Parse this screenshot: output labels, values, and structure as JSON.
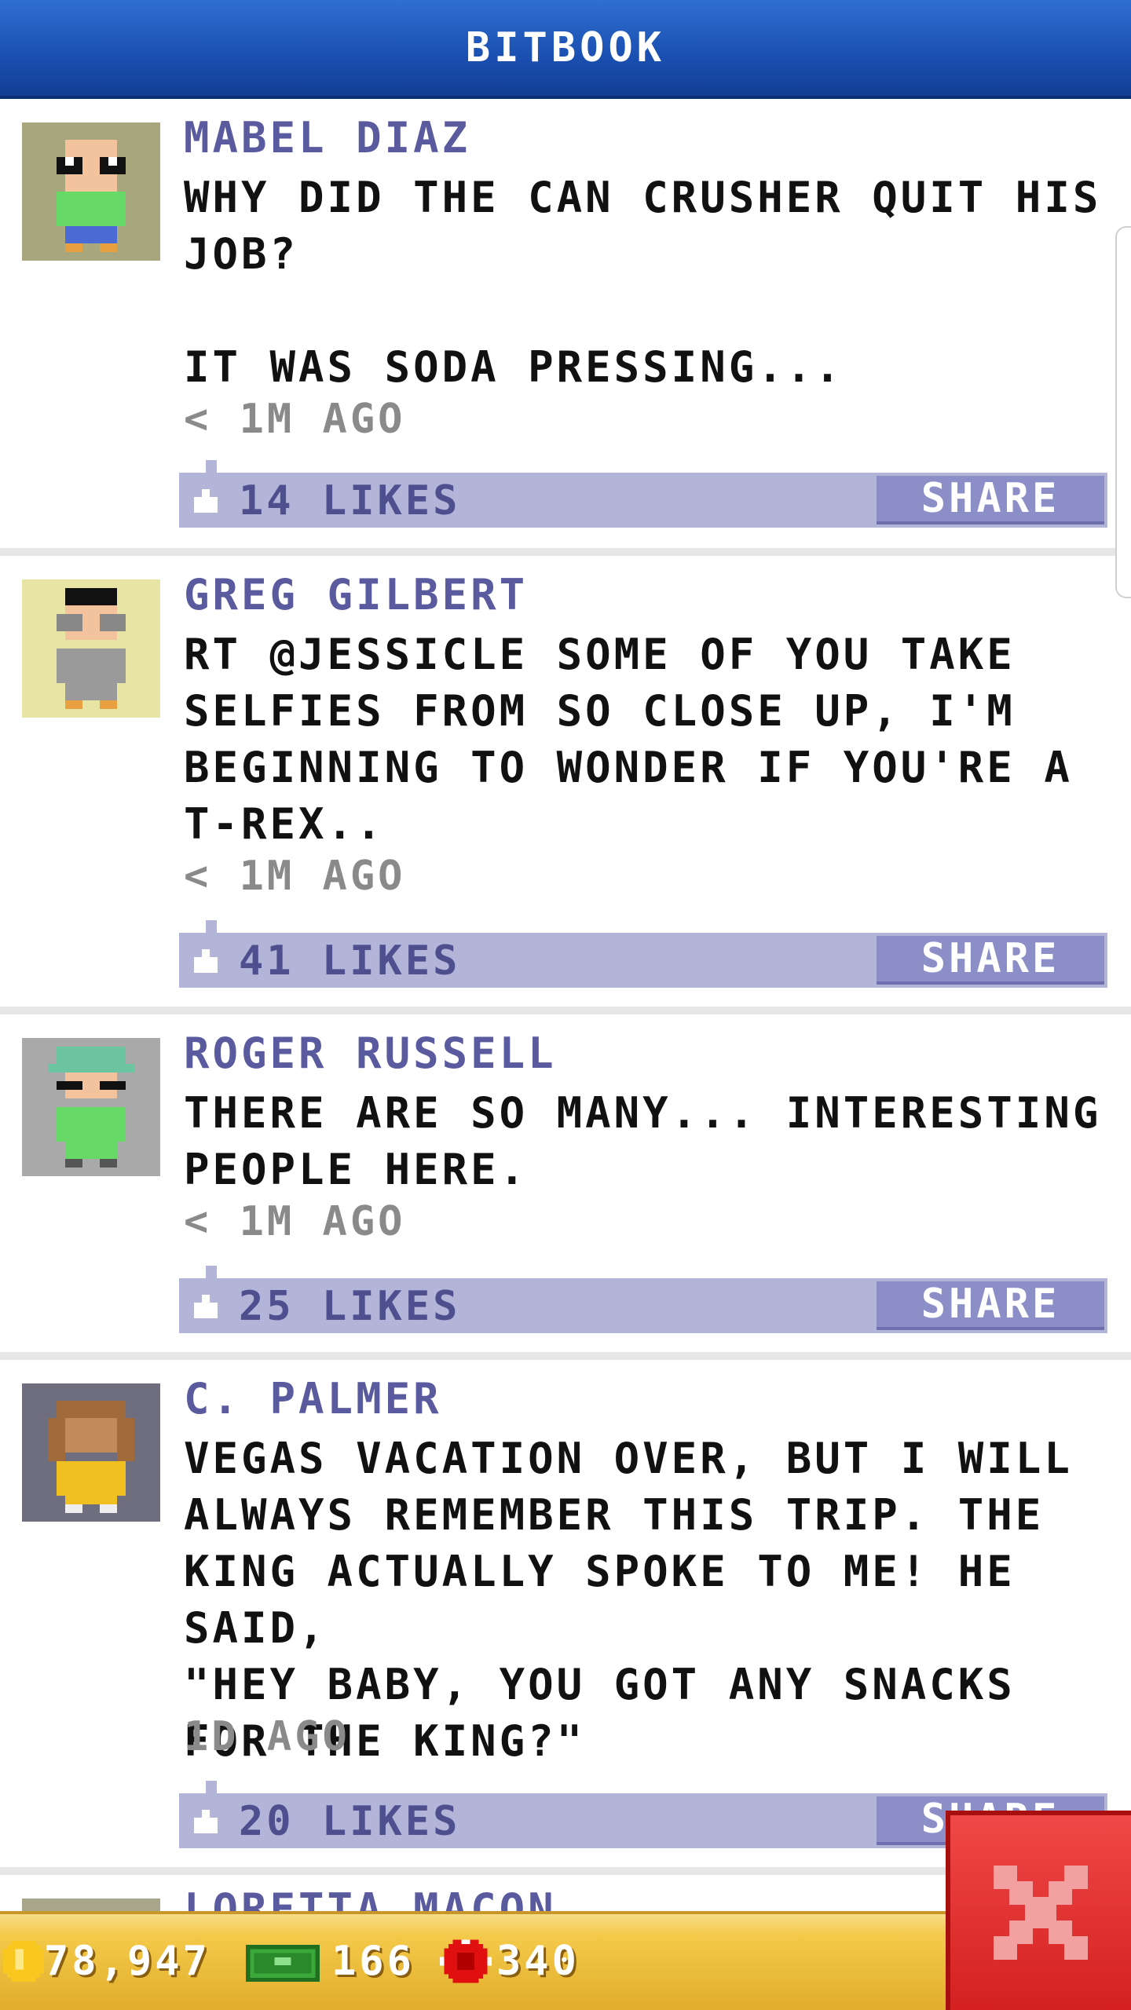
{
  "header": {
    "title": "BITBOOK"
  },
  "posts": [
    {
      "author": "MABEL DIAZ",
      "text": "WHY DID THE CAN CRUSHER QUIT HIS\nJOB?\n\nIT WAS SODA PRESSING...",
      "time": "< 1M AGO",
      "likes": "14 LIKES",
      "share": "SHARE",
      "avatar_bg": "#a8a67c"
    },
    {
      "author": "GREG GILBERT",
      "text": "RT @JESSICLE SOME OF YOU TAKE\nSELFIES FROM SO CLOSE UP, I'M\nBEGINNING TO WONDER IF YOU'RE A\nT-REX..",
      "time": "< 1M AGO",
      "likes": "41 LIKES",
      "share": "SHARE",
      "avatar_bg": "#e8e4a4"
    },
    {
      "author": "ROGER RUSSELL",
      "text": "THERE ARE SO MANY... INTERESTING\nPEOPLE HERE.",
      "time": "< 1M AGO",
      "likes": "25 LIKES",
      "share": "SHARE",
      "avatar_bg": "#a9a9a9"
    },
    {
      "author": "C. PALMER",
      "text": "VEGAS VACATION OVER, BUT I WILL\nALWAYS REMEMBER THIS TRIP. THE\nKING ACTUALLY SPOKE TO ME! HE SAID,\n\"HEY BABY, YOU GOT ANY SNACKS\nFOR THE KING?\"",
      "time": "1D AGO",
      "likes": "20 LIKES",
      "share": "SHARE",
      "avatar_bg": "#6e6e7e"
    }
  ],
  "partial_post": {
    "author": "LORETTA MACON"
  },
  "status": {
    "coins": "78,947",
    "bux": "166",
    "tokens": "340"
  },
  "colors": {
    "accent": "#1a4fb0",
    "like_bar": "#b3b5d8",
    "share": "#8c8fc7",
    "close": "#e03030"
  },
  "icons": {
    "like": "thumbs-up-icon",
    "coin": "coin-icon",
    "bux": "bux-icon",
    "token": "token-icon",
    "close": "close-icon"
  }
}
